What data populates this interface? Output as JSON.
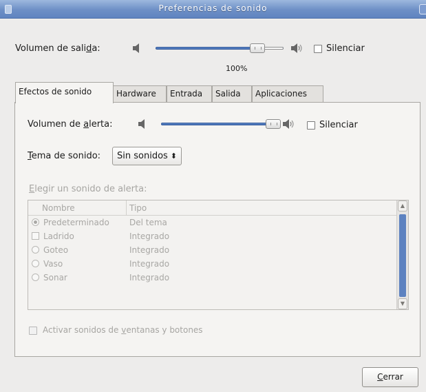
{
  "window": {
    "title": "Preferencias de sonido"
  },
  "output": {
    "label_pre": "Volumen de sali",
    "label_mnemonic": "d",
    "label_post": "a:",
    "level_fraction": 0.8,
    "percent_text": "100%",
    "mute_label": "Silenciar",
    "mute_checked": false
  },
  "tabs": [
    {
      "label": "Efectos de sonido",
      "active": true
    },
    {
      "label": "Hardware",
      "active": false
    },
    {
      "label": "Entrada",
      "active": false
    },
    {
      "label": "Salida",
      "active": false
    },
    {
      "label": "Aplicaciones",
      "active": false
    }
  ],
  "effects": {
    "alert_volume": {
      "label_pre": "Volumen de ",
      "label_mnemonic": "a",
      "label_post": "lerta:",
      "level_fraction": 1.0,
      "mute_label": "Silenciar",
      "mute_checked": false
    },
    "theme": {
      "label_mnemonic": "T",
      "label_post": "ema de sonido:",
      "selected": "Sin sonidos"
    },
    "choose_alert": {
      "label_mnemonic": "E",
      "label_post": "legir un sonido de alerta:"
    },
    "sound_list": {
      "columns": [
        "Nombre",
        "Tipo"
      ],
      "rows": [
        {
          "name": "Predeterminado",
          "type": "Del tema",
          "marker": "radio",
          "checked": true
        },
        {
          "name": "Ladrido",
          "type": "Integrado",
          "marker": "check",
          "checked": false
        },
        {
          "name": "Goteo",
          "type": "Integrado",
          "marker": "radio",
          "checked": false
        },
        {
          "name": "Vaso",
          "type": "Integrado",
          "marker": "radio",
          "checked": false
        },
        {
          "name": "Sonar",
          "type": "Integrado",
          "marker": "radio",
          "checked": false
        }
      ]
    },
    "window_sounds": {
      "label_pre": "Activar sonidos de ",
      "label_mnemonic": "v",
      "label_post": "entanas y botones",
      "checked": false
    }
  },
  "close_button": {
    "label_mnemonic": "C",
    "label_post": "errar"
  },
  "colors": {
    "titlebar": "#6d8fc6",
    "slider_fill": "#3e69b2",
    "window_bg": "#edeceb"
  }
}
